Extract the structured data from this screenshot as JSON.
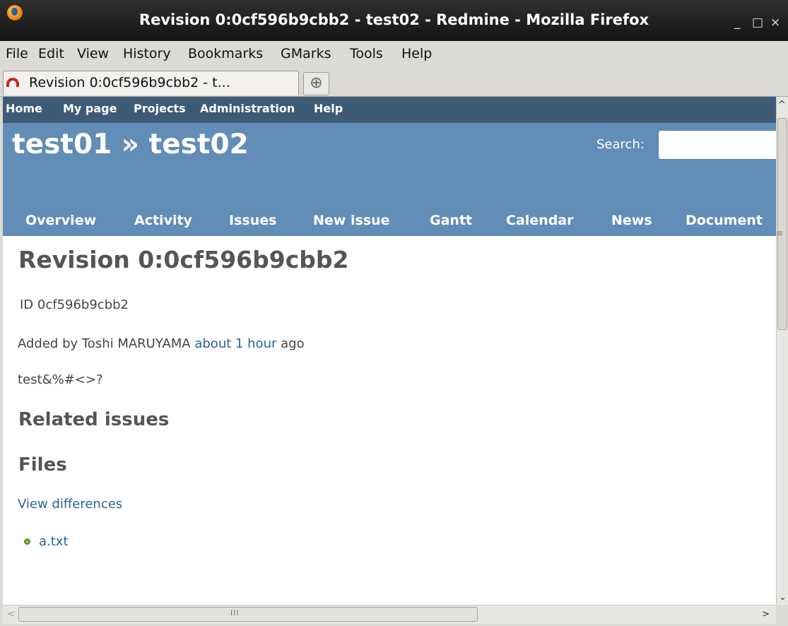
{
  "window": {
    "title": "Revision 0:0cf596b9cbb2 - test02 - Redmine - Mozilla Firefox",
    "minimize": "_",
    "maximize": "□",
    "close": "×"
  },
  "menubar": [
    "File",
    "Edit",
    "View",
    "History",
    "Bookmarks",
    "GMarks",
    "Tools",
    "Help"
  ],
  "tab": {
    "label": "Revision 0:0cf596b9cbb2 - t...",
    "new_tab": "⊕"
  },
  "top_menu": [
    "Home",
    "My page",
    "Projects",
    "Administration",
    "Help"
  ],
  "header": {
    "title": "test01 » test02",
    "search_label": "Search:",
    "search_value": ""
  },
  "main_menu": [
    "Overview",
    "Activity",
    "Issues",
    "New issue",
    "Gantt",
    "Calendar",
    "News",
    "Document"
  ],
  "content": {
    "heading": "Revision 0:0cf596b9cbb2",
    "id_line": "ID 0cf596b9cbb2",
    "added_by_prefix": "Added by Toshi MARUYAMA ",
    "added_by_link": "about 1 hour",
    "added_by_suffix": " ago",
    "comment": "test&%#<>?",
    "related_issues": "Related issues",
    "files": "Files",
    "view_differences": "View differences",
    "file_item": "a.txt"
  },
  "colors": {
    "top_menu_bg": "#3e5b76",
    "header_bg": "#628db6",
    "link": "#2a6496"
  }
}
